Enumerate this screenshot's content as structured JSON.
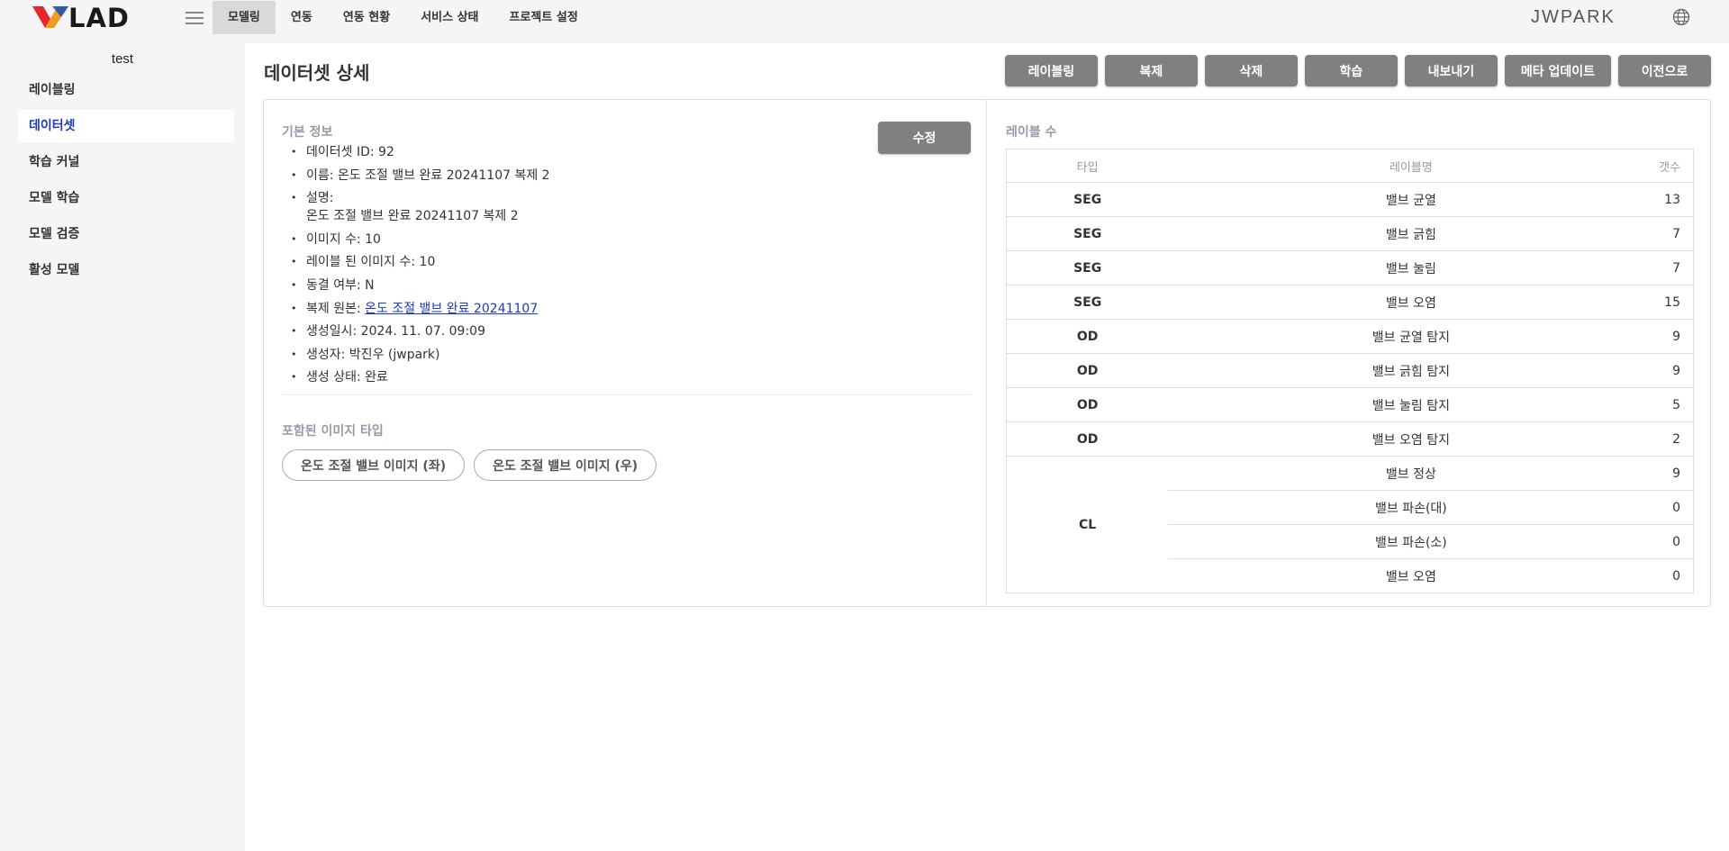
{
  "header": {
    "logo_text": "VLAD",
    "nav": [
      "모델링",
      "연동",
      "연동 현황",
      "서비스 상태",
      "프로젝트 설정"
    ],
    "active_nav": 0,
    "username": "JWPARK"
  },
  "sidebar": {
    "project": "test",
    "items": [
      "레이블링",
      "데이터셋",
      "학습 커널",
      "모델 학습",
      "모델 검증",
      "활성 모델"
    ],
    "active": 1
  },
  "page": {
    "title": "데이터셋 상세",
    "actions": [
      "레이블링",
      "복제",
      "삭제",
      "학습",
      "내보내기",
      "메타 업데이트",
      "이전으로"
    ]
  },
  "basic_info": {
    "label": "기본 정보",
    "edit_label": "수정",
    "id": "데이터셋 ID: 92",
    "name": "이름: 온도 조절 밸브 완료 20241107 복제 2",
    "desc_label": "설명:",
    "desc_value": "온도 조절 밸브 완료 20241107 복제 2",
    "image_count": "이미지 수: 10",
    "labeled_count": "레이블 된 이미지 수: 10",
    "frozen": "동결 여부: N",
    "source_label": "복제 원본: ",
    "source_link": "온도 조절 밸브 완료 20241107",
    "created_at": "생성일시: 2024. 11. 07. 09:09",
    "creator": "생성자: 박진우 (jwpark)",
    "status": "생성 상태: 완료"
  },
  "image_types": {
    "label": "포함된 이미지 타입",
    "chips": [
      "온도 조절 밸브 이미지 (좌)",
      "온도 조절 밸브 이미지 (우)"
    ]
  },
  "label_table": {
    "label": "레이블 수",
    "headers": [
      "타입",
      "레이블명",
      "갯수"
    ],
    "rows": [
      {
        "type": "SEG",
        "name": "밸브 균열",
        "count": "13"
      },
      {
        "type": "SEG",
        "name": "밸브 긁힘",
        "count": "7"
      },
      {
        "type": "SEG",
        "name": "밸브 눌림",
        "count": "7"
      },
      {
        "type": "SEG",
        "name": "밸브 오염",
        "count": "15"
      },
      {
        "type": "OD",
        "name": "밸브 균열 탐지",
        "count": "9"
      },
      {
        "type": "OD",
        "name": "밸브 긁힘 탐지",
        "count": "9"
      },
      {
        "type": "OD",
        "name": "밸브 눌림 탐지",
        "count": "5"
      },
      {
        "type": "OD",
        "name": "밸브 오염 탐지",
        "count": "2"
      }
    ],
    "cl_type": "CL",
    "cl_rows": [
      {
        "name": "밸브 정상",
        "count": "9"
      },
      {
        "name": "밸브 파손(대)",
        "count": "0"
      },
      {
        "name": "밸브 파손(소)",
        "count": "0"
      },
      {
        "name": "밸브 오염",
        "count": "0"
      }
    ]
  },
  "colors": {
    "accent": "#1d3bbf",
    "button": "#808080",
    "logo_orange": "#f29b1d",
    "logo_red": "#e8262d",
    "logo_blue": "#1a55b8"
  }
}
